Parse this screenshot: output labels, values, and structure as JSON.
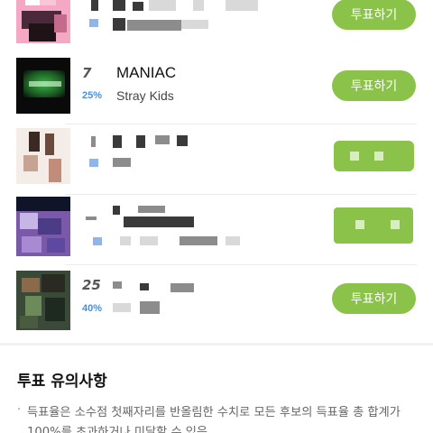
{
  "list": {
    "items": [
      {
        "rank": "",
        "percent": "",
        "title": "",
        "artist": "",
        "button_label": "투표하기",
        "obscured": true
      },
      {
        "rank": "7",
        "percent": "25%",
        "title": "MANIAC",
        "artist": "Stray Kids",
        "button_label": "투표하기",
        "obscured": false
      },
      {
        "rank": "",
        "percent": "",
        "title": "",
        "artist": "",
        "button_label": "",
        "obscured": true
      },
      {
        "rank": "",
        "percent": "",
        "title": "",
        "artist": "",
        "button_label": "",
        "obscured": true
      },
      {
        "rank": "25",
        "percent": "40%",
        "title": "",
        "artist": "",
        "button_label": "투표하기",
        "obscured": true
      }
    ]
  },
  "notice": {
    "title": "투표 유의사항",
    "bullet": "·",
    "lines": [
      "득표율은 소수점 첫째자리를 반올림한 수치로 모든 후보의 득표율 총 합계가",
      "100%를 초과하거나 미달할 수 있음"
    ]
  },
  "colors": {
    "vote_button": "#8bc34a",
    "percent_text": "#4a8fd9",
    "background": "#ffffff"
  }
}
